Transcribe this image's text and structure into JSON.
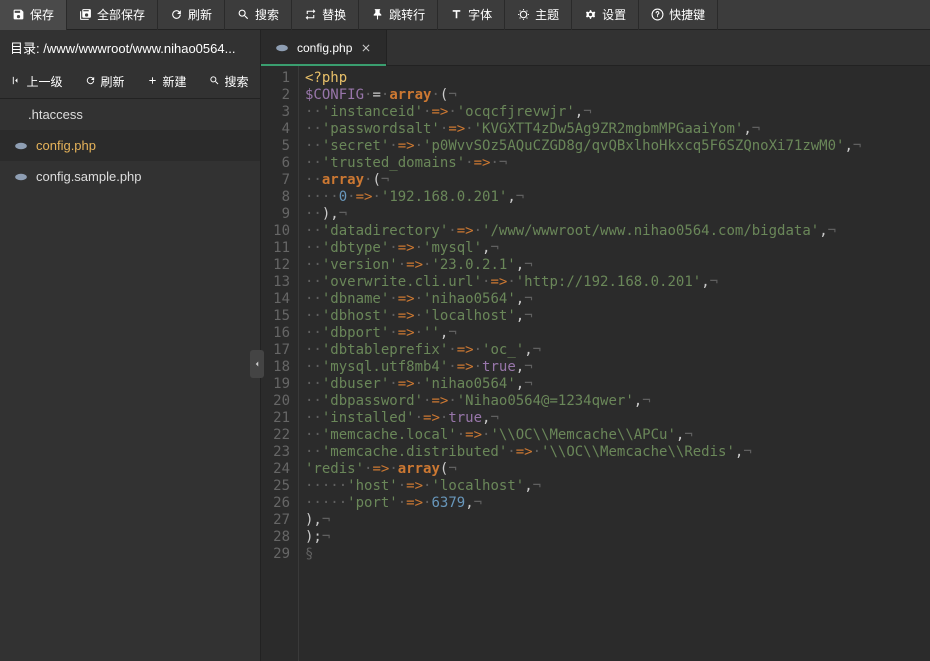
{
  "toolbar": {
    "save": "保存",
    "saveAll": "全部保存",
    "refresh": "刷新",
    "search": "搜索",
    "replace": "替换",
    "gotoLine": "跳转行",
    "font": "字体",
    "theme": "主题",
    "settings": "设置",
    "shortcuts": "快捷键"
  },
  "sidebar": {
    "pathLabel": "目录:",
    "pathValue": " /www/wwwroot/www.nihao0564...",
    "up": "上一级",
    "refresh": "刷新",
    "new": "新建",
    "search": "搜索",
    "files": [
      {
        "name": ".htaccess",
        "active": false,
        "icon": false
      },
      {
        "name": "config.php",
        "active": true,
        "icon": true
      },
      {
        "name": "config.sample.php",
        "active": false,
        "icon": true
      }
    ]
  },
  "tabs": [
    {
      "name": "config.php",
      "active": true
    }
  ],
  "code": {
    "lines": [
      {
        "n": 1,
        "html": "<span class='tok-tag'>&lt;?php</span>"
      },
      {
        "n": 2,
        "html": "<span class='tok-var'>$CONFIG</span><span class='tok-dot'>·</span><span class='tok-eq'>=</span><span class='tok-dot'>·</span><span class='tok-kw'>array</span><span class='tok-dot'>·</span><span class='tok-punc'>(</span><span class='tok-nl'>¬</span>"
      },
      {
        "n": 3,
        "html": "<span class='tok-dot'>··</span><span class='tok-str'>'instanceid'</span><span class='tok-dot'>·</span><span class='tok-arrow'>=&gt;</span><span class='tok-dot'>·</span><span class='tok-str'>'ocqcfjrevwjr'</span><span class='tok-punc'>,</span><span class='tok-nl'>¬</span>"
      },
      {
        "n": 4,
        "html": "<span class='tok-dot'>··</span><span class='tok-str'>'passwordsalt'</span><span class='tok-dot'>·</span><span class='tok-arrow'>=&gt;</span><span class='tok-dot'>·</span><span class='tok-str'>'KVGXTT4zDw5Ag9ZR2mgbmMPGaaiYom'</span><span class='tok-punc'>,</span><span class='tok-nl'>¬</span>"
      },
      {
        "n": 5,
        "html": "<span class='tok-dot'>··</span><span class='tok-str'>'secret'</span><span class='tok-dot'>·</span><span class='tok-arrow'>=&gt;</span><span class='tok-dot'>·</span><span class='tok-str'>'p0WvvSOz5AQuCZGD8g/qvQBxlhoHkxcq5F6SZQnoXi71zwM0'</span><span class='tok-punc'>,</span><span class='tok-nl'>¬</span>"
      },
      {
        "n": 6,
        "html": "<span class='tok-dot'>··</span><span class='tok-str'>'trusted_domains'</span><span class='tok-dot'>·</span><span class='tok-arrow'>=&gt;</span><span class='tok-dot'>·</span><span class='tok-nl'>¬</span>"
      },
      {
        "n": 7,
        "html": "<span class='tok-dot'>··</span><span class='tok-kw'>array</span><span class='tok-dot'>·</span><span class='tok-punc'>(</span><span class='tok-nl'>¬</span>"
      },
      {
        "n": 8,
        "html": "<span class='tok-dot'>····</span><span class='tok-num'>0</span><span class='tok-dot'>·</span><span class='tok-arrow'>=&gt;</span><span class='tok-dot'>·</span><span class='tok-str'>'192.168.0.201'</span><span class='tok-punc'>,</span><span class='tok-nl'>¬</span>"
      },
      {
        "n": 9,
        "html": "<span class='tok-dot'>··</span><span class='tok-punc'>),</span><span class='tok-nl'>¬</span>"
      },
      {
        "n": 10,
        "html": "<span class='tok-dot'>··</span><span class='tok-str'>'datadirectory'</span><span class='tok-dot'>·</span><span class='tok-arrow'>=&gt;</span><span class='tok-dot'>·</span><span class='tok-str'>'/www/wwwroot/www.nihao0564.com/bigdata'</span><span class='tok-punc'>,</span><span class='tok-nl'>¬</span>"
      },
      {
        "n": 11,
        "html": "<span class='tok-dot'>··</span><span class='tok-str'>'dbtype'</span><span class='tok-dot'>·</span><span class='tok-arrow'>=&gt;</span><span class='tok-dot'>·</span><span class='tok-str'>'mysql'</span><span class='tok-punc'>,</span><span class='tok-nl'>¬</span>"
      },
      {
        "n": 12,
        "html": "<span class='tok-dot'>··</span><span class='tok-str'>'version'</span><span class='tok-dot'>·</span><span class='tok-arrow'>=&gt;</span><span class='tok-dot'>·</span><span class='tok-str'>'23.0.2.1'</span><span class='tok-punc'>,</span><span class='tok-nl'>¬</span>"
      },
      {
        "n": 13,
        "html": "<span class='tok-dot'>··</span><span class='tok-str'>'overwrite.cli.url'</span><span class='tok-dot'>·</span><span class='tok-arrow'>=&gt;</span><span class='tok-dot'>·</span><span class='tok-str'>'http://192.168.0.201'</span><span class='tok-punc'>,</span><span class='tok-nl'>¬</span>"
      },
      {
        "n": 14,
        "html": "<span class='tok-dot'>··</span><span class='tok-str'>'dbname'</span><span class='tok-dot'>·</span><span class='tok-arrow'>=&gt;</span><span class='tok-dot'>·</span><span class='tok-str'>'nihao0564'</span><span class='tok-punc'>,</span><span class='tok-nl'>¬</span>"
      },
      {
        "n": 15,
        "html": "<span class='tok-dot'>··</span><span class='tok-str'>'dbhost'</span><span class='tok-dot'>·</span><span class='tok-arrow'>=&gt;</span><span class='tok-dot'>·</span><span class='tok-str'>'localhost'</span><span class='tok-punc'>,</span><span class='tok-nl'>¬</span>"
      },
      {
        "n": 16,
        "html": "<span class='tok-dot'>··</span><span class='tok-str'>'dbport'</span><span class='tok-dot'>·</span><span class='tok-arrow'>=&gt;</span><span class='tok-dot'>·</span><span class='tok-str'>''</span><span class='tok-punc'>,</span><span class='tok-nl'>¬</span>"
      },
      {
        "n": 17,
        "html": "<span class='tok-dot'>··</span><span class='tok-str'>'dbtableprefix'</span><span class='tok-dot'>·</span><span class='tok-arrow'>=&gt;</span><span class='tok-dot'>·</span><span class='tok-str'>'oc_'</span><span class='tok-punc'>,</span><span class='tok-nl'>¬</span>"
      },
      {
        "n": 18,
        "html": "<span class='tok-dot'>··</span><span class='tok-str'>'mysql.utf8mb4'</span><span class='tok-dot'>·</span><span class='tok-arrow'>=&gt;</span><span class='tok-dot'>·</span><span class='tok-bool'>true</span><span class='tok-punc'>,</span><span class='tok-nl'>¬</span>"
      },
      {
        "n": 19,
        "html": "<span class='tok-dot'>··</span><span class='tok-str'>'dbuser'</span><span class='tok-dot'>·</span><span class='tok-arrow'>=&gt;</span><span class='tok-dot'>·</span><span class='tok-str'>'nihao0564'</span><span class='tok-punc'>,</span><span class='tok-nl'>¬</span>"
      },
      {
        "n": 20,
        "html": "<span class='tok-dot'>··</span><span class='tok-str'>'dbpassword'</span><span class='tok-dot'>·</span><span class='tok-arrow'>=&gt;</span><span class='tok-dot'>·</span><span class='tok-str'>'Nihao0564@=1234qwer'</span><span class='tok-punc'>,</span><span class='tok-nl'>¬</span>"
      },
      {
        "n": 21,
        "html": "<span class='tok-dot'>··</span><span class='tok-str'>'installed'</span><span class='tok-dot'>·</span><span class='tok-arrow'>=&gt;</span><span class='tok-dot'>·</span><span class='tok-bool'>true</span><span class='tok-punc'>,</span><span class='tok-nl'>¬</span>"
      },
      {
        "n": 22,
        "html": "<span class='tok-dot'>··</span><span class='tok-str'>'memcache.local'</span><span class='tok-dot'>·</span><span class='tok-arrow'>=&gt;</span><span class='tok-dot'>·</span><span class='tok-str'>'\\\\OC\\\\Memcache\\\\APCu'</span><span class='tok-punc'>,</span><span class='tok-nl'>¬</span>"
      },
      {
        "n": 23,
        "html": "<span class='tok-dot'>··</span><span class='tok-str'>'memcache.distributed'</span><span class='tok-dot'>·</span><span class='tok-arrow'>=&gt;</span><span class='tok-dot'>·</span><span class='tok-str'>'\\\\OC\\\\Memcache\\\\Redis'</span><span class='tok-punc'>,</span><span class='tok-nl'>¬</span>"
      },
      {
        "n": 24,
        "html": "<span class='tok-str'>'redis'</span><span class='tok-dot'>·</span><span class='tok-arrow'>=&gt;</span><span class='tok-dot'>·</span><span class='tok-kw'>array</span><span class='tok-punc'>(</span><span class='tok-nl'>¬</span>"
      },
      {
        "n": 25,
        "html": "<span class='tok-dot'>·····</span><span class='tok-str'>'host'</span><span class='tok-dot'>·</span><span class='tok-arrow'>=&gt;</span><span class='tok-dot'>·</span><span class='tok-str'>'localhost'</span><span class='tok-punc'>,</span><span class='tok-nl'>¬</span>"
      },
      {
        "n": 26,
        "html": "<span class='tok-dot'>·····</span><span class='tok-str'>'port'</span><span class='tok-dot'>·</span><span class='tok-arrow'>=&gt;</span><span class='tok-dot'>·</span><span class='tok-num'>6379</span><span class='tok-punc'>,</span><span class='tok-nl'>¬</span>"
      },
      {
        "n": 27,
        "html": "<span class='tok-punc'>),</span><span class='tok-nl'>¬</span>"
      },
      {
        "n": 28,
        "html": "<span class='tok-punc'>);</span><span class='tok-nl'>¬</span>"
      },
      {
        "n": 29,
        "html": "<span class='tok-dot'>§</span>"
      }
    ]
  }
}
